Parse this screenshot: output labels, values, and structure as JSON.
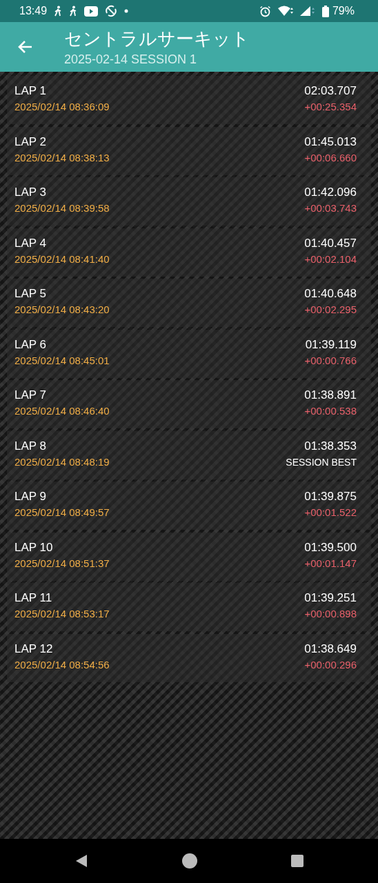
{
  "status_bar": {
    "time": "13:49",
    "battery": "79%"
  },
  "app_bar": {
    "title": "セントラルサーキット",
    "subtitle": "2025-02-14 SESSION 1"
  },
  "laps": [
    {
      "name": "LAP 1",
      "timestamp": "2025/02/14 08:36:09",
      "time": "02:03.707",
      "note": "+00:25.354",
      "kind": "delta"
    },
    {
      "name": "LAP 2",
      "timestamp": "2025/02/14 08:38:13",
      "time": "01:45.013",
      "note": "+00:06.660",
      "kind": "delta"
    },
    {
      "name": "LAP 3",
      "timestamp": "2025/02/14 08:39:58",
      "time": "01:42.096",
      "note": "+00:03.743",
      "kind": "delta"
    },
    {
      "name": "LAP 4",
      "timestamp": "2025/02/14 08:41:40",
      "time": "01:40.457",
      "note": "+00:02.104",
      "kind": "delta"
    },
    {
      "name": "LAP 5",
      "timestamp": "2025/02/14 08:43:20",
      "time": "01:40.648",
      "note": "+00:02.295",
      "kind": "delta"
    },
    {
      "name": "LAP 6",
      "timestamp": "2025/02/14 08:45:01",
      "time": "01:39.119",
      "note": "+00:00.766",
      "kind": "delta"
    },
    {
      "name": "LAP 7",
      "timestamp": "2025/02/14 08:46:40",
      "time": "01:38.891",
      "note": "+00:00.538",
      "kind": "delta"
    },
    {
      "name": "LAP 8",
      "timestamp": "2025/02/14 08:48:19",
      "time": "01:38.353",
      "note": "SESSION BEST",
      "kind": "best"
    },
    {
      "name": "LAP 9",
      "timestamp": "2025/02/14 08:49:57",
      "time": "01:39.875",
      "note": "+00:01.522",
      "kind": "delta"
    },
    {
      "name": "LAP 10",
      "timestamp": "2025/02/14 08:51:37",
      "time": "01:39.500",
      "note": "+00:01.147",
      "kind": "delta"
    },
    {
      "name": "LAP 11",
      "timestamp": "2025/02/14 08:53:17",
      "time": "01:39.251",
      "note": "+00:00.898",
      "kind": "delta"
    },
    {
      "name": "LAP 12",
      "timestamp": "2025/02/14 08:54:56",
      "time": "01:38.649",
      "note": "+00:00.296",
      "kind": "delta"
    }
  ]
}
